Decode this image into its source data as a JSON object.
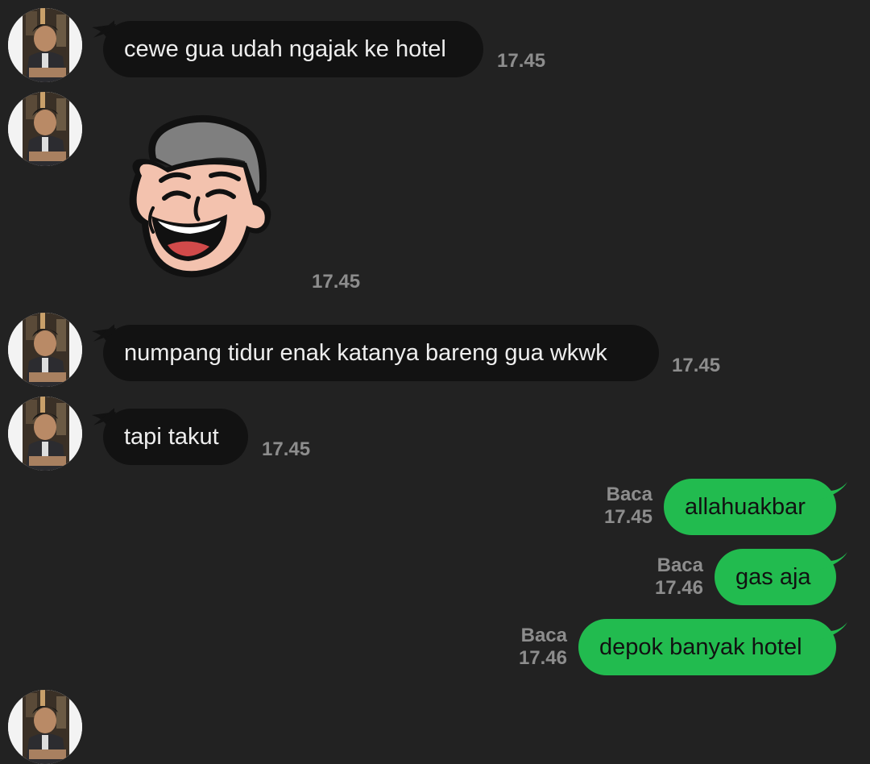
{
  "messages": [
    {
      "side": "in",
      "text": "cewe gua udah ngajak ke hotel",
      "time": "17.45"
    },
    {
      "side": "in",
      "sticker": "laughing-man-sticker",
      "time": "17.45"
    },
    {
      "side": "in",
      "text": "numpang tidur enak katanya bareng gua wkwk",
      "time": "17.45"
    },
    {
      "side": "in",
      "text": "tapi takut",
      "time": "17.45"
    },
    {
      "side": "out",
      "text": "allahuakbar",
      "status": "Baca",
      "time": "17.45"
    },
    {
      "side": "out",
      "text": "gas aja",
      "status": "Baca",
      "time": "17.46"
    },
    {
      "side": "out",
      "text": "depok banyak hotel",
      "status": "Baca",
      "time": "17.46"
    }
  ],
  "colors": {
    "background": "#222222",
    "incoming_bubble": "#121212",
    "outgoing_bubble": "#22bb4f",
    "timestamp": "#8d8d8d"
  }
}
